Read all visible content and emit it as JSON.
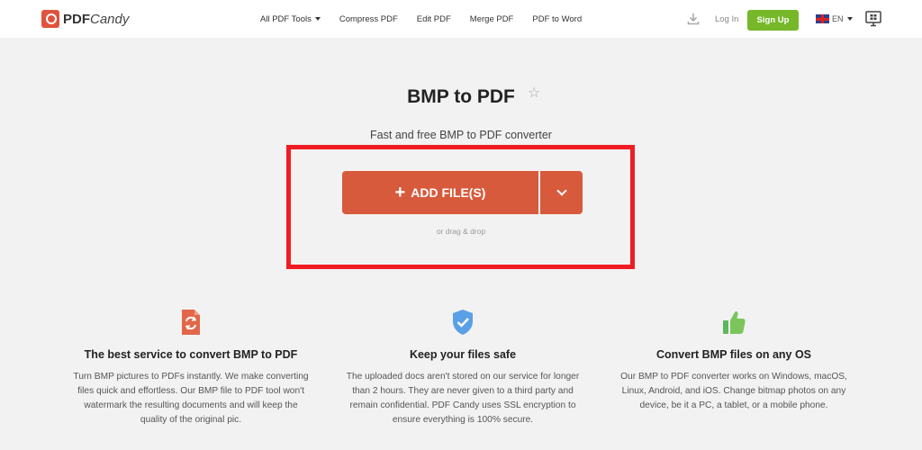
{
  "header": {
    "logo_pdf": "PDF",
    "logo_candy": "Candy",
    "nav": [
      {
        "label": "All PDF Tools"
      },
      {
        "label": "Compress PDF"
      },
      {
        "label": "Edit PDF"
      },
      {
        "label": "Merge PDF"
      },
      {
        "label": "PDF to Word"
      }
    ],
    "login": "Log In",
    "signup": "Sign Up",
    "language": "EN",
    "icons": [
      "download-icon",
      "uk-flag-icon",
      "windows-app-icon"
    ]
  },
  "hero": {
    "title": "BMP to PDF",
    "subtitle": "Fast and free BMP to PDF converter",
    "add_files": "ADD FILE(S)",
    "drag_drop": "or drag & drop"
  },
  "features": [
    {
      "icon": "refresh-file-icon",
      "title": "The best service to convert BMP to PDF",
      "text": "Turn BMP pictures to PDFs instantly. We make converting files quick and effortless. Our BMP file to PDF tool won't watermark the resulting documents and will keep the quality of the original pic."
    },
    {
      "icon": "shield-check-icon",
      "title": "Keep your files safe",
      "text": "The uploaded docs aren't stored on our service for longer than 2 hours. They are never given to a third party and remain confidential. PDF Candy uses SSL encryption to ensure everything is 100% secure."
    },
    {
      "icon": "thumbs-up-icon",
      "title": "Convert BMP files on any OS",
      "text": "Our BMP to PDF converter works on Windows, macOS, Linux, Android, and iOS. Change bitmap photos on any device, be it a PC, a tablet, or a mobile phone."
    }
  ],
  "colors": {
    "accent": "#d85a3c",
    "signup": "#76b82a",
    "highlight": "#ef1d23",
    "background": "#f2f2f2"
  }
}
